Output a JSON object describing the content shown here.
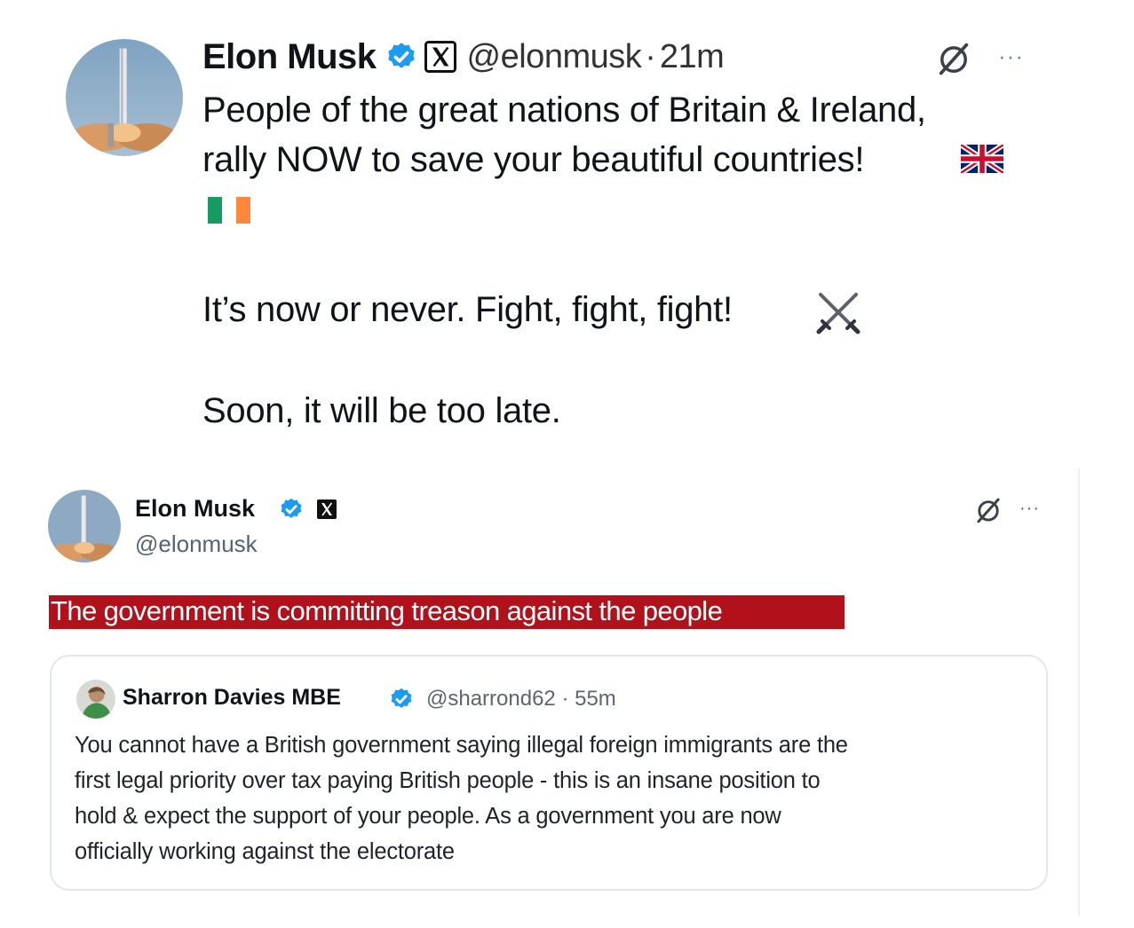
{
  "tweet1": {
    "author_name": "Elon Musk",
    "handle": "@elonmusk",
    "separator": "·",
    "time": "21m",
    "more_label": "···",
    "lines": [
      "People of the great nations of Britain & Ireland,",
      "rally NOW to save your beautiful countries!",
      "It’s now or never. Fight, fight, fight!",
      "Soon, it will be too late."
    ],
    "emoji": [
      "uk-flag",
      "ireland-flag",
      "crossed-swords"
    ]
  },
  "tweet2": {
    "author_name": "Elon Musk",
    "handle": "@elonmusk",
    "more_label": "···",
    "text": "The government is committing treason against the people",
    "highlight_color": "#b0111b",
    "quote": {
      "author_name": "Sharron Davies MBE",
      "handle_time": "@sharrond62 · 55m",
      "lines": [
        "You cannot have a British government saying illegal foreign  immigrants are the",
        "first legal priority over tax paying British people - this is an insane position to",
        "hold & expect the support of your people. As a government you are now",
        "officially working against the electorate"
      ]
    }
  },
  "colors": {
    "verified_blue": "#1d9bf0",
    "text": "#0f1419",
    "muted": "#536471"
  }
}
